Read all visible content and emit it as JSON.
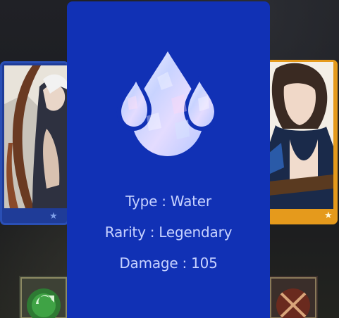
{
  "card": {
    "element_icon": "water-drop-icon",
    "type_label": "Type",
    "type_value": "Water",
    "rarity_label": "Rarity",
    "rarity_value": "Legendary",
    "damage_label": "Damage",
    "damage_value": "105",
    "separator": ":"
  },
  "background": {
    "left_card_icon": "star-icon",
    "right_card_icon": "star-icon",
    "left_button_icon": "refresh-icon",
    "right_button_icon": "crossed-swords-icon"
  },
  "colors": {
    "modal": "#1131b5",
    "stat_text": "#c7d2ff",
    "left_card_frame": "#1f3c98",
    "right_card_frame": "#e59a1c"
  }
}
